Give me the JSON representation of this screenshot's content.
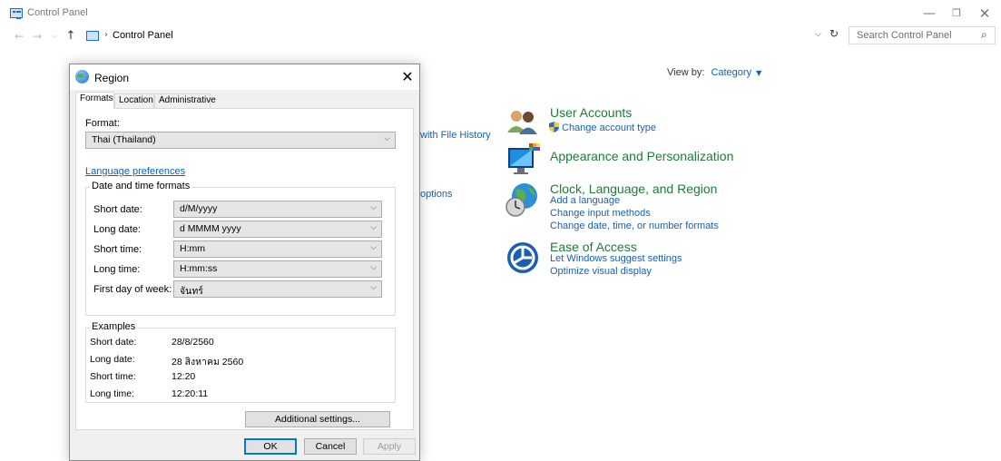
{
  "window": {
    "title": "Control Panel",
    "minimize_glyph": "—",
    "restore_glyph": "❐",
    "close_glyph": "✕"
  },
  "nav": {
    "back_glyph": "←",
    "forward_glyph": "→",
    "recent_glyph": "⌵",
    "up_glyph": "↑",
    "breadcrumb_sep": "›",
    "breadcrumb": "Control Panel",
    "address_dropdown_glyph": "⌵",
    "refresh_glyph": "↻",
    "search_placeholder": "Search Control Panel",
    "search_glyph": "⌕"
  },
  "main": {
    "view_by_label": "View by:",
    "view_by_value": "Category",
    "view_by_caret": "▼",
    "partial_links": [
      "with File History",
      "options"
    ],
    "categories": [
      {
        "title": "User Accounts",
        "icon": "users-icon",
        "links": [
          "Change account type"
        ]
      },
      {
        "title": "Appearance and Personalization",
        "icon": "monitor-palette-icon",
        "links": []
      },
      {
        "title": "Clock, Language, and Region",
        "icon": "globe-clock-icon",
        "links": [
          "Add a language",
          "Change input methods",
          "Change date, time, or number formats"
        ]
      },
      {
        "title": "Ease of Access",
        "icon": "ease-of-access-icon",
        "links": [
          "Let Windows suggest settings",
          "Optimize visual display"
        ]
      }
    ]
  },
  "dialog": {
    "title": "Region",
    "close_glyph": "✕",
    "tabs": [
      "Formats",
      "Location",
      "Administrative"
    ],
    "format_label": "Format:",
    "format_value": "Thai (Thailand)",
    "language_preferences": "Language preferences",
    "date_time_caption": "Date and time formats",
    "chevron_glyph": "⌵",
    "fields": [
      {
        "label": "Short date:",
        "value": "d/M/yyyy"
      },
      {
        "label": "Long date:",
        "value": "d MMMM yyyy"
      },
      {
        "label": "Short time:",
        "value": "H:mm"
      },
      {
        "label": "Long time:",
        "value": "H:mm:ss"
      },
      {
        "label": "First day of week:",
        "value": "จันทร์"
      }
    ],
    "examples_caption": "Examples",
    "examples": [
      {
        "label": "Short date:",
        "value": "28/8/2560"
      },
      {
        "label": "Long date:",
        "value": "28 สิงหาคม 2560"
      },
      {
        "label": "Short time:",
        "value": "12:20"
      },
      {
        "label": "Long time:",
        "value": "12:20:11"
      }
    ],
    "additional_settings": "Additional settings...",
    "ok": "OK",
    "cancel": "Cancel",
    "apply": "Apply"
  }
}
